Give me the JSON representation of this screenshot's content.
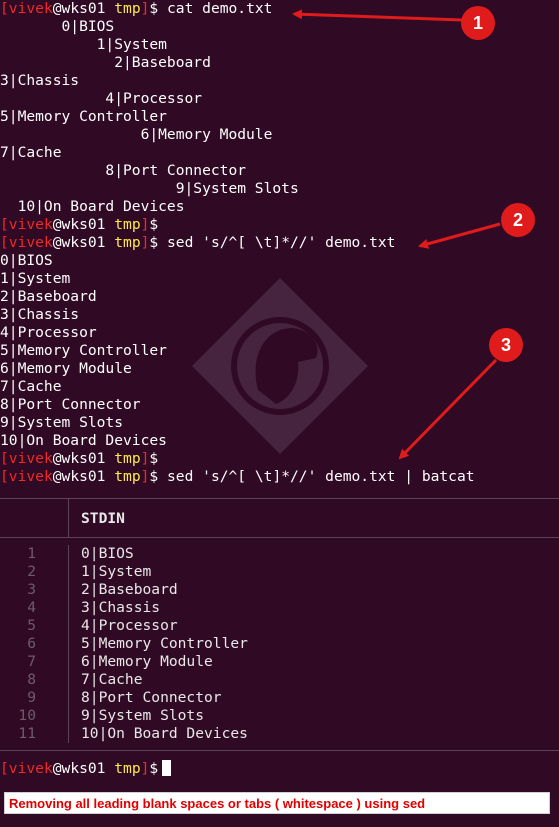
{
  "prompt": {
    "user": "vivek",
    "host": "wks01",
    "path": "tmp",
    "open_bracket": "[",
    "close_bracket": "]",
    "at": "@",
    "dollar": "$"
  },
  "commands": {
    "cmd1": "cat demo.txt",
    "cmd2": "sed 's/^[ \\t]*//' demo.txt",
    "cmd3": "sed 's/^[ \\t]*//' demo.txt | batcat"
  },
  "cat_output": [
    "       0|BIOS",
    "           1|System",
    "             2|Baseboard",
    "3|Chassis",
    "            4|Processor",
    "5|Memory Controller",
    "                6|Memory Module",
    "7|Cache",
    "            8|Port Connector",
    "                    9|System Slots",
    "  10|On Board Devices"
  ],
  "sed_output": [
    "0|BIOS",
    "1|System",
    "2|Baseboard",
    "3|Chassis",
    "4|Processor",
    "5|Memory Controller",
    "6|Memory Module",
    "7|Cache",
    "8|Port Connector",
    "9|System Slots",
    "10|On Board Devices"
  ],
  "batcat": {
    "header": "STDIN",
    "line_numbers": [
      "1",
      "2",
      "3",
      "4",
      "5",
      "6",
      "7",
      "8",
      "9",
      "10",
      "11"
    ],
    "lines": [
      "0|BIOS",
      "1|System",
      "2|Baseboard",
      "3|Chassis",
      "4|Processor",
      "5|Memory Controller",
      "6|Memory Module",
      "7|Cache",
      "8|Port Connector",
      "9|System Slots",
      "10|On Board Devices"
    ]
  },
  "annotations": {
    "badge1": "1",
    "badge2": "2",
    "badge3": "3"
  },
  "caption": "Removing all leading blank spaces or tabs ( whitespace ) using sed",
  "colors": {
    "background": "#300a24",
    "prompt_user": "#ef2929",
    "prompt_path": "#fce94f",
    "annotation": "#e01b1b",
    "caption_text": "#e00000"
  }
}
